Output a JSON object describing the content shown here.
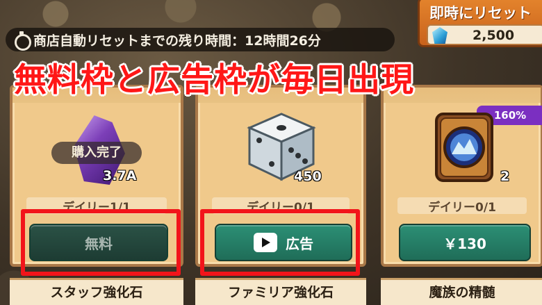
{
  "header": {
    "reset_timer_text": "商店自動リセットまでの残り時間：12時間26分",
    "instant_reset": {
      "label": "即時にリセット",
      "price": "2,500",
      "currency_icon": "gem-icon"
    }
  },
  "overlay_headline": "無料枠と広告枠が毎日出現",
  "cards": [
    {
      "item_icon": "purple-crystal",
      "purchased_badge": "購入完了",
      "quantity": "3.7A",
      "daily_limit": "デイリー1/1",
      "button_label": "無料",
      "button_state": "disabled",
      "item_name": "スタッフ強化石",
      "highlighted": true
    },
    {
      "item_icon": "dice",
      "quantity": "450",
      "daily_limit": "デイリー0/1",
      "button_label": "広告",
      "button_icon": "play-icon",
      "item_name": "ファミリア強化石",
      "highlighted": true
    },
    {
      "item_icon": "portal-card",
      "bonus_tag": "160%",
      "quantity": "2",
      "daily_limit": "デイリー0/1",
      "button_label": "￥130",
      "item_name": "魔族の精髄",
      "highlighted": false
    }
  ],
  "colors": {
    "highlight_frame": "#f2141a",
    "button_green": "#2c8f75",
    "card_bg": "#f0c98b",
    "bonus_purple": "#7b2fc1"
  }
}
